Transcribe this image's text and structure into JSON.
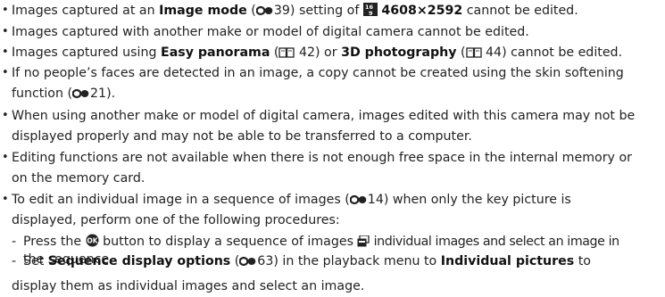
{
  "bullets": [
    {
      "a": "Images captured at an ",
      "b": "Image mode",
      "c": " (",
      "ref": "39",
      "d": ") setting of ",
      "e": "4608×2592",
      "f": " cannot be edited."
    },
    {
      "a": "Images captured with another make or model of digital camera cannot be edited."
    },
    {
      "a": "Images captured using ",
      "b": "Easy panorama",
      "c": " (",
      "ref1": " 42) or ",
      "d": "3D photography",
      "e": " (",
      "ref2": " 44) cannot be edited."
    },
    {
      "line1": "If no people’s faces are detected in an image, a copy cannot be created using the skin softening",
      "line2a": "function (",
      "ref": "21",
      "line2b": ")."
    },
    {
      "line1": "When using another make or model of digital camera, images edited with this camera may not be",
      "line2": "displayed properly and may not be able to be transferred to a computer."
    },
    {
      "line1": "Editing functions are not available when there is not enough free space in the internal memory or",
      "line2": "on the memory card."
    },
    {
      "line1a": "To edit an individual image in a sequence of images (",
      "ref": "14",
      "line1b": ") when only the key picture is",
      "line2": "displayed, perform one of the following procedures:"
    }
  ],
  "subitems": [
    {
      "dash": "-",
      "line1a": "Press the ",
      "line1b": " button to display a sequence of images ",
      "line1c": " individual images and select an image in",
      "line2": "the sequence."
    },
    {
      "dash": "-",
      "line1a": "Set ",
      "line1b": "Sequence display options",
      "line1c": " (",
      "ref": "63",
      "line1d": ") in the playback menu to ",
      "line1e": "Individual pictures",
      "line1f": " to",
      "line2": "display them as individual images and select an image."
    }
  ],
  "icons": {
    "ref_link": "reference-link-icon",
    "book": "book-reference-icon",
    "image_size": "image-size-16x9-icon",
    "ok_button": "ok-button-icon",
    "sequence": "sequence-icon"
  }
}
